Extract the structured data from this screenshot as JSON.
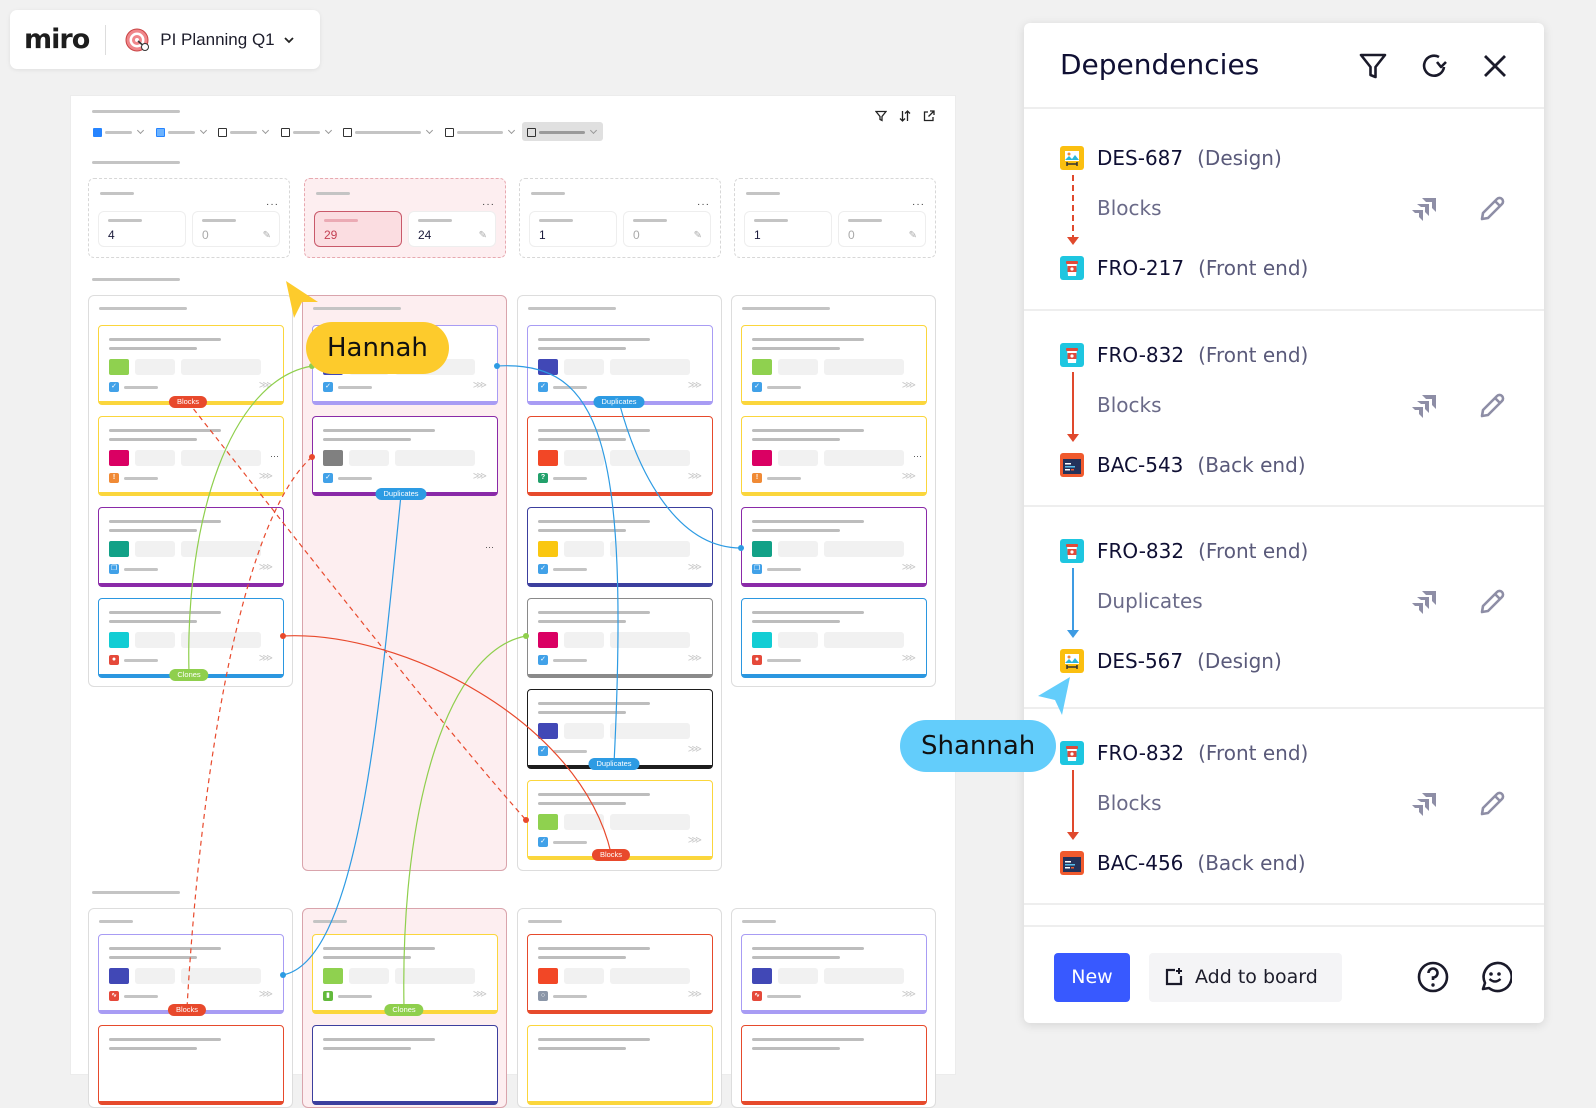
{
  "app": {
    "logo": "miro",
    "board_name": "PI Planning Q1",
    "board_icon": "target-icon"
  },
  "board": {
    "toolbar_icons": [
      "filter-icon",
      "sort-icon",
      "external-link-icon"
    ],
    "summaries": [
      {
        "stats": [
          {
            "value": "4"
          },
          {
            "value": "0",
            "editable": true
          }
        ],
        "highlighted": false
      },
      {
        "stats": [
          {
            "value": "29",
            "alert": true
          },
          {
            "value": "24",
            "editable": true
          }
        ],
        "highlighted": true
      },
      {
        "stats": [
          {
            "value": "1"
          },
          {
            "value": "0",
            "editable": true
          }
        ],
        "highlighted": false
      },
      {
        "stats": [
          {
            "value": "1"
          },
          {
            "value": "0",
            "editable": true
          }
        ],
        "highlighted": false
      }
    ],
    "dependency_tags": {
      "blocks": "Blocks",
      "duplicates": "Duplicates",
      "clones": "Clones"
    },
    "colors": {
      "blocks": "#e8492c",
      "duplicates": "#2d9be3",
      "clones": "#8fcf4d"
    }
  },
  "collaborators": [
    {
      "name": "Hannah",
      "color": "#fdcb2c"
    },
    {
      "name": "Shannah",
      "color": "#63cdfb"
    }
  ],
  "panel": {
    "title": "Dependencies",
    "header_icons": [
      "filter-icon",
      "refresh-icon",
      "close-icon"
    ],
    "dependencies": [
      {
        "from": {
          "key": "DES-687",
          "project": "(Design)",
          "type": "design"
        },
        "relation": "Blocks",
        "line_style": "dashed",
        "to": {
          "key": "FRO-217",
          "project": "(Front end)",
          "type": "frontend"
        }
      },
      {
        "from": {
          "key": "FRO-832",
          "project": "(Front end)",
          "type": "frontend"
        },
        "relation": "Blocks",
        "line_style": "solid-red",
        "to": {
          "key": "BAC-543",
          "project": "(Back end)",
          "type": "backend"
        }
      },
      {
        "from": {
          "key": "FRO-832",
          "project": "(Front end)",
          "type": "frontend"
        },
        "relation": "Duplicates",
        "line_style": "solid-blue",
        "to": {
          "key": "DES-567",
          "project": "(Design)",
          "type": "design"
        }
      },
      {
        "from": {
          "key": "FRO-832",
          "project": "(Front end)",
          "type": "frontend"
        },
        "relation": "Blocks",
        "line_style": "solid-red",
        "to": {
          "key": "BAC-456",
          "project": "(Back end)",
          "type": "backend"
        }
      }
    ],
    "row_actions": [
      "jira-icon",
      "edit-pencil-icon"
    ],
    "footer": {
      "new_label": "New",
      "add_to_board_label": "Add to board",
      "icons": [
        "help-icon",
        "feedback-smiley-icon"
      ]
    }
  }
}
